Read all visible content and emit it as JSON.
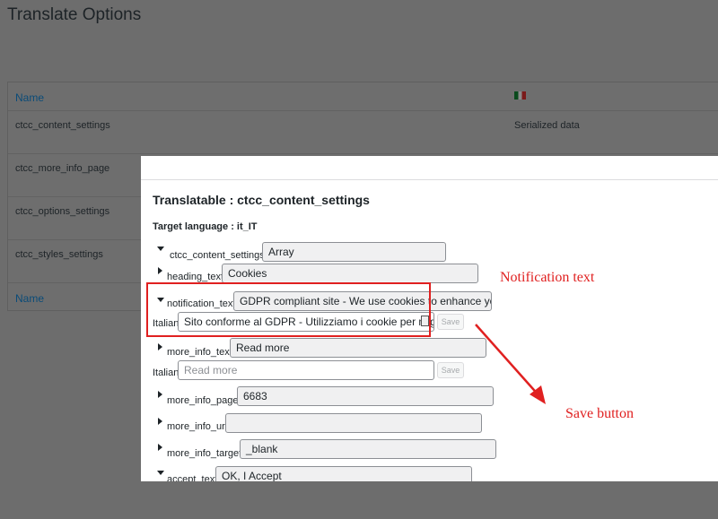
{
  "page": {
    "title": "Translate Options"
  },
  "background_table": {
    "header_name": "Name",
    "footer_name": "Name",
    "flag_icon": "italy-flag-icon",
    "rows": [
      {
        "name": "ctcc_content_settings",
        "value": "Serialized data"
      },
      {
        "name": "ctcc_more_info_page",
        "value": ""
      },
      {
        "name": "ctcc_options_settings",
        "value": ""
      },
      {
        "name": "ctcc_styles_settings",
        "value": ""
      }
    ]
  },
  "modal": {
    "title": "Translatable : ctcc_content_settings",
    "target_language": "Target language : it_IT",
    "fields": {
      "content_settings": {
        "label": "ctcc_content_settings",
        "value": "Array"
      },
      "heading_text": {
        "label": "heading_text",
        "value": "Cookies"
      },
      "notification_text": {
        "label": "notification_text",
        "value": "GDPR compliant site - We use cookies to enhance you",
        "italian_label": "Italian",
        "italian_value": "Sito conforme al GDPR - Utilizziamo i cookie per miglio",
        "save_label": "Save"
      },
      "more_info_text": {
        "label": "more_info_text",
        "value": "Read more",
        "italian_label": "Italian",
        "italian_placeholder": "Read more",
        "save_label": "Save"
      },
      "more_info_page": {
        "label": "more_info_page",
        "value": "6683"
      },
      "more_info_url": {
        "label": "more_info_url",
        "value": ""
      },
      "more_info_target": {
        "label": "more_info_target",
        "value": "_blank"
      },
      "accept_text": {
        "label": "accept_text",
        "value": "OK, I Accept"
      }
    }
  },
  "annotations": {
    "notification_text": "Notification text",
    "save_button": "Save button",
    "color": "#e02020"
  }
}
